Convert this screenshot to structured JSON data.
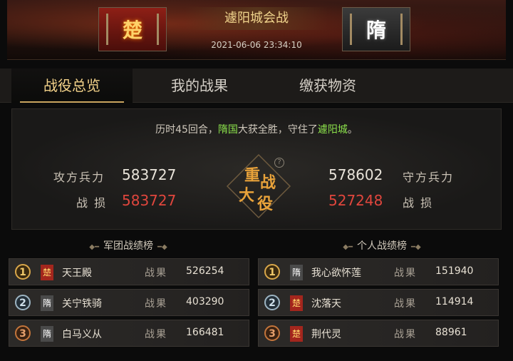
{
  "header": {
    "attacker_faction": "楚",
    "defender_faction": "隋",
    "title": "遽阳城会战",
    "timestamp": "2021-06-06  23:34:10"
  },
  "tabs": [
    {
      "label": "战役总览",
      "active": true
    },
    {
      "label": "我的战果",
      "active": false
    },
    {
      "label": "缴获物资",
      "active": false
    }
  ],
  "overview": {
    "summary_prefix": "历时45回合，",
    "winner": "隋国",
    "summary_mid": "大获全胜，守住了",
    "city": "遽阳城",
    "summary_suffix": "。",
    "attack_label": "攻方兵力",
    "attack_value": "583727",
    "attack_loss_label": "战 损",
    "attack_loss_value": "583727",
    "defend_label": "守方兵力",
    "defend_value": "578602",
    "defend_loss_label": "战 损",
    "defend_loss_value": "527248",
    "emblem_text": [
      "重",
      "战",
      "大",
      "役"
    ],
    "help_icon": "?"
  },
  "legion_rank": {
    "title": "军团战绩榜",
    "rows": [
      {
        "rank": "1",
        "faction": "楚",
        "name": "天王殿",
        "label": "战果",
        "value": "526254"
      },
      {
        "rank": "2",
        "faction": "隋",
        "name": "关宁铁骑",
        "label": "战果",
        "value": "403290"
      },
      {
        "rank": "3",
        "faction": "隋",
        "name": "白马义从",
        "label": "战果",
        "value": "166481"
      }
    ]
  },
  "personal_rank": {
    "title": "个人战绩榜",
    "rows": [
      {
        "rank": "1",
        "faction": "隋",
        "name": "我心欲怀莲",
        "label": "战果",
        "value": "151940"
      },
      {
        "rank": "2",
        "faction": "楚",
        "name": "沈落天",
        "label": "战果",
        "value": "114914"
      },
      {
        "rank": "3",
        "faction": "楚",
        "name": "荆代灵",
        "label": "战果",
        "value": "88961"
      }
    ]
  },
  "colors": {
    "accent_gold": "#f2d189",
    "loss_red": "#e0463d",
    "highlight_green": "#8be04b"
  }
}
